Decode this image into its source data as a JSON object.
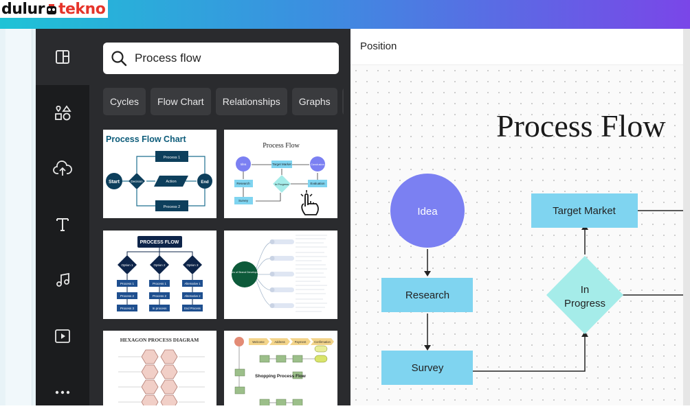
{
  "watermark": {
    "brand_left": "dulur",
    "brand_right": "tekno"
  },
  "rail": {
    "items": [
      {
        "name": "design",
        "icon": "layout-icon"
      },
      {
        "name": "elements",
        "icon": "shapes-icon"
      },
      {
        "name": "uploads",
        "icon": "cloud-upload-icon"
      },
      {
        "name": "text",
        "icon": "text-icon"
      },
      {
        "name": "audio",
        "icon": "music-note-icon"
      },
      {
        "name": "videos",
        "icon": "video-play-icon"
      },
      {
        "name": "more",
        "icon": "more-dots-icon"
      }
    ]
  },
  "search": {
    "value": "Process flow"
  },
  "chips": [
    "Cycles",
    "Flow Chart",
    "Relationships",
    "Graphs",
    "T"
  ],
  "templates": {
    "t1": {
      "title": "Process Flow Chart",
      "nodes": [
        "Start",
        "Process 1",
        "Decision",
        "Action",
        "End",
        "Process 2"
      ]
    },
    "t2": {
      "title": "Process Flow",
      "nodes": [
        "Idea",
        "Target Market",
        "Conclusion",
        "Research",
        "In Progress",
        "Evaluation",
        "Survey"
      ]
    },
    "t3": {
      "title": "PROCESS FLOW",
      "options": [
        "Option 1",
        "Option 2",
        "Option 3"
      ],
      "rows": [
        [
          "Process 1",
          "Process 1",
          "Alternative 1"
        ],
        [
          "Process 2",
          "Process 2",
          "Alternative 2"
        ],
        [
          "Process 3",
          "In process",
          "End Process"
        ]
      ]
    },
    "t4": {
      "center": "Stages of Brand Development"
    },
    "t5": {
      "title": "HEXAGON PROCESS DIAGRAM"
    },
    "t6": {
      "steps": [
        "Welcome",
        "Address",
        "Payment",
        "Confirmation"
      ],
      "title": "Shopping Process Flow"
    }
  },
  "canvas": {
    "header": "Position",
    "title": "Process Flow",
    "nodes": {
      "idea": "Idea",
      "target_market": "Target Market",
      "research": "Research",
      "in_progress": "In Progress",
      "survey": "Survey"
    },
    "colors": {
      "circle": "#7b80f2",
      "box": "#7fd4f0",
      "diamond": "#a5ece9",
      "title": "#1a1a1a"
    }
  }
}
